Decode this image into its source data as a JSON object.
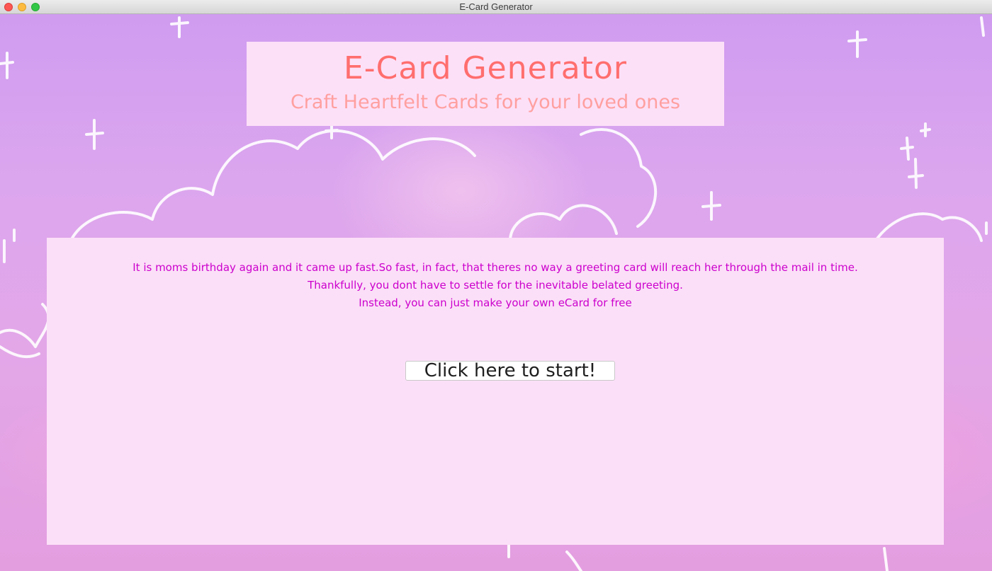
{
  "window": {
    "title": "E-Card Generator"
  },
  "header": {
    "title": "E-Card Generator",
    "subtitle": "Craft Heartfelt Cards for your loved ones"
  },
  "intro": {
    "lines": [
      "It is moms birthday again and it came up fast.So fast, in fact, that theres no way a greeting card will reach her through the mail in time.",
      "Thankfully, you dont have to settle for the inevitable belated greeting.",
      "Instead, you can just make your own eCard for free"
    ]
  },
  "start_button": {
    "label": "Click here to start!"
  },
  "colors": {
    "title": "#ff6e6e",
    "subtitle": "#ffa0a0",
    "intro_text": "#cc00cc",
    "panel": "#fbdff8",
    "background": "#d8a6ee"
  },
  "icons": {
    "close": "close-icon",
    "minimize": "minimize-icon",
    "maximize": "maximize-icon"
  }
}
